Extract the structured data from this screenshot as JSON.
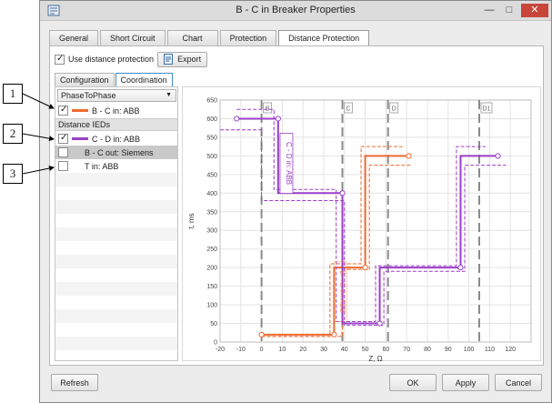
{
  "window": {
    "title": "B - C in Breaker Properties",
    "minimize": "—",
    "maximize": "□",
    "close": "✕"
  },
  "tabs": [
    {
      "label": "General"
    },
    {
      "label": "Short Circuit"
    },
    {
      "label": "Chart"
    },
    {
      "label": "Protection"
    },
    {
      "label": "Distance Protection",
      "active": true
    }
  ],
  "use_distance_protection": {
    "label": "Use distance protection",
    "checked": true
  },
  "export_button": {
    "label": "Export",
    "icon": "export-icon"
  },
  "subtabs": [
    {
      "label": "Configuration"
    },
    {
      "label": "Coordination",
      "active": true
    }
  ],
  "left_panel": {
    "mode_select": {
      "value": "PhaseToPhase"
    },
    "main_ied": {
      "label": "B - C in: ABB",
      "checked": true,
      "color": "#ee6a30"
    },
    "distance_ieds_header": "Distance IEDs",
    "ieds": [
      {
        "label": "C - D in: ABB",
        "checked": true,
        "color": "#9b3fc8",
        "has_swatch": true
      },
      {
        "label": "B - C out: Siemens",
        "checked": false,
        "selected": true,
        "has_swatch": false
      },
      {
        "label": "T in: ABB",
        "checked": false,
        "has_swatch": false
      }
    ]
  },
  "callouts": [
    "1",
    "2",
    "3"
  ],
  "buttons": {
    "refresh": "Refresh",
    "ok": "OK",
    "apply": "Apply",
    "cancel": "Cancel"
  },
  "chart_data": {
    "type": "line",
    "xlabel": "Z, Ω",
    "ylabel": "t, ms",
    "xlim": [
      -20,
      130
    ],
    "ylim": [
      0,
      650
    ],
    "x_ticks": [
      -20,
      -10,
      0,
      10,
      20,
      30,
      40,
      50,
      60,
      70,
      80,
      90,
      100,
      110,
      120
    ],
    "y_ticks": [
      0,
      50,
      100,
      150,
      200,
      250,
      300,
      350,
      400,
      450,
      500,
      550,
      600,
      650
    ],
    "grid": true,
    "bus_lines": [
      {
        "name": "B",
        "x": 0
      },
      {
        "name": "C",
        "x": 39
      },
      {
        "name": "D",
        "x": 61
      },
      {
        "name": "D1",
        "x": 105
      }
    ],
    "series": [
      {
        "name": "B - C in: ABB",
        "color": "#ee6a30",
        "points": [
          [
            0,
            20
          ],
          [
            35,
            20
          ],
          [
            35,
            200
          ],
          [
            50,
            200
          ],
          [
            50,
            500
          ],
          [
            71,
            500
          ]
        ],
        "dashed_upper": [
          [
            0,
            15
          ],
          [
            33,
            15
          ],
          [
            33,
            210
          ],
          [
            48,
            210
          ],
          [
            48,
            525
          ],
          [
            68,
            525
          ]
        ],
        "dashed_lower": [
          [
            0,
            15
          ],
          [
            39,
            15
          ],
          [
            39,
            195
          ],
          [
            52,
            195
          ],
          [
            52,
            475
          ],
          [
            72,
            475
          ]
        ]
      },
      {
        "name": "C - D in: ABB",
        "color": "#9b3fc8",
        "points": [
          [
            -12,
            600
          ],
          [
            8,
            600
          ],
          [
            8,
            400
          ],
          [
            39,
            400
          ],
          [
            39,
            50
          ],
          [
            57,
            50
          ],
          [
            57,
            200
          ],
          [
            96,
            200
          ],
          [
            96,
            500
          ],
          [
            114,
            500
          ]
        ],
        "dashed_upper": [
          [
            -12,
            625
          ],
          [
            6,
            625
          ],
          [
            6,
            410
          ],
          [
            36,
            410
          ],
          [
            36,
            55
          ],
          [
            55,
            55
          ],
          [
            55,
            205
          ],
          [
            94,
            205
          ],
          [
            94,
            525
          ],
          [
            108,
            525
          ]
        ],
        "dashed_lower": [
          [
            -20,
            570
          ],
          [
            0,
            570
          ],
          [
            0,
            380
          ],
          [
            40,
            380
          ],
          [
            40,
            45
          ],
          [
            59,
            45
          ],
          [
            59,
            190
          ],
          [
            98,
            190
          ],
          [
            98,
            475
          ],
          [
            118,
            475
          ]
        ]
      }
    ],
    "annotations": [
      {
        "text": "C - D in: ABB",
        "color": "#9b3fc8"
      },
      {
        "text": "B - C in: ABB",
        "color": "#ee6a30"
      }
    ]
  }
}
